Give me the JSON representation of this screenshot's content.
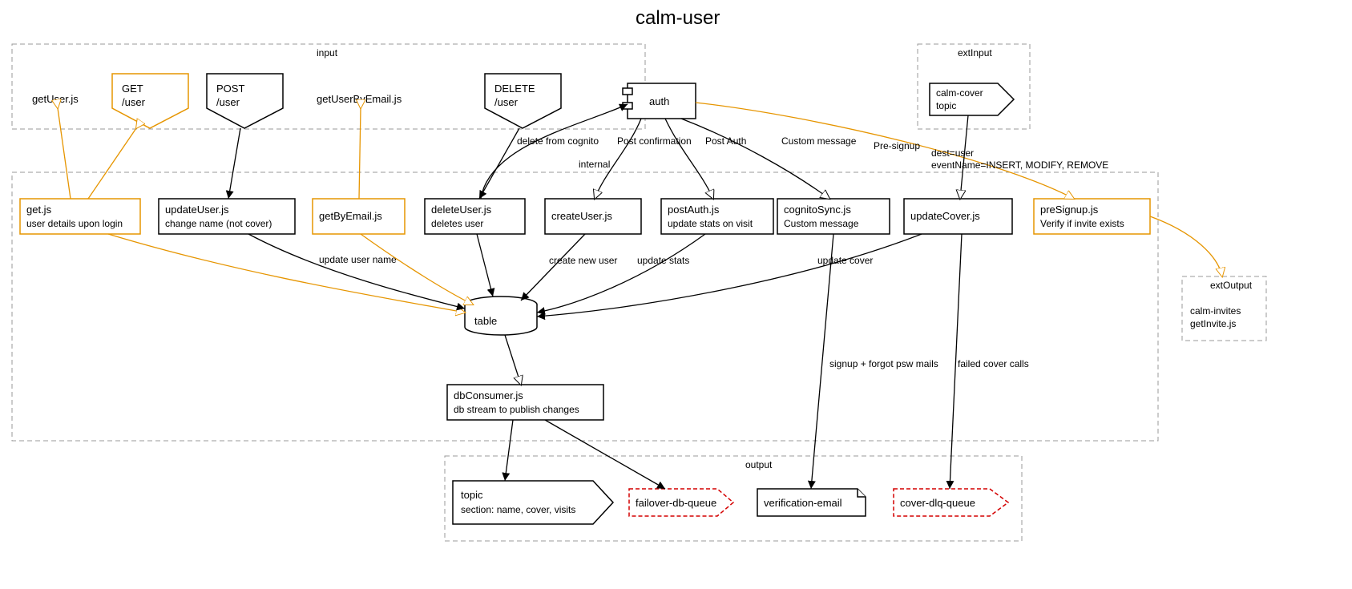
{
  "title": "calm-user",
  "clusters": {
    "input": "input",
    "extInput": "extInput",
    "output": "output",
    "extOutput": "extOutput"
  },
  "topLabels": {
    "getUser": "getUser.js",
    "getUserByEmail": "getUserByEmail.js"
  },
  "pentagons": {
    "getUser": {
      "l1": "GET",
      "l2": "/user"
    },
    "postUser": {
      "l1": "POST",
      "l2": "/user"
    },
    "deleteUser": {
      "l1": "DELETE",
      "l2": "/user"
    }
  },
  "auth": "auth",
  "extInputTopic": {
    "l1": "calm-cover",
    "l2": "topic"
  },
  "lambdas": {
    "get": {
      "title": "get.js",
      "sub": "user details upon login"
    },
    "updateUser": {
      "title": "updateUser.js",
      "sub": "change name (not cover)"
    },
    "getByEmail": {
      "title": "getByEmail.js",
      "sub": ""
    },
    "deleteUser": {
      "title": "deleteUser.js",
      "sub": "deletes user"
    },
    "createUser": {
      "title": "createUser.js",
      "sub": ""
    },
    "postAuth": {
      "title": "postAuth.js",
      "sub": "update stats on visit"
    },
    "cognitoSync": {
      "title": "cognitoSync.js",
      "sub": "Custom message"
    },
    "updateCover": {
      "title": "updateCover.js",
      "sub": ""
    },
    "preSignup": {
      "title": "preSignup.js",
      "sub": "Verify if invite exists"
    }
  },
  "table": "table",
  "dbConsumer": {
    "title": "dbConsumer.js",
    "sub": "db stream to publish changes"
  },
  "outputs": {
    "topic": {
      "title": "topic",
      "sub": "section:  name, cover, visits"
    },
    "failover": "failover-db-queue",
    "verification": "verification-email",
    "coverDlq": "cover-dlq-queue"
  },
  "extOutput": {
    "l1": "calm-invites",
    "l2": "getInvite.js"
  },
  "edges": {
    "deleteCognito": "delete from cognito",
    "internal": "internal",
    "postConfirmation": "Post confirmation",
    "postAuth": "Post Auth",
    "customMessage": "Custom message",
    "preSignup": "Pre-signup",
    "destUser": "dest=user",
    "eventName": "eventName=INSERT, MODIFY, REMOVE",
    "updateUserName": "update user name",
    "createNewUser": "create new user",
    "updateStats": "update stats",
    "updateCover": "update cover",
    "signupForgot": "signup + forgot psw mails",
    "failedCover": "failed cover calls"
  }
}
